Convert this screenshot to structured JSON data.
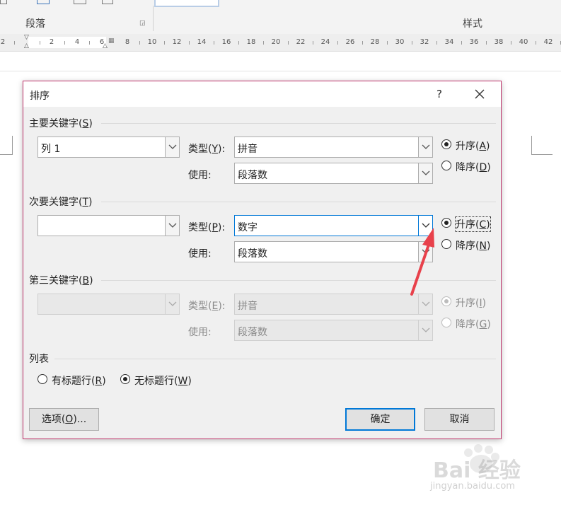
{
  "ribbon": {
    "paragraph_group": "段落",
    "styles_group": "样式"
  },
  "ruler": {
    "left_numbers": [
      "2",
      "2",
      "4",
      "6"
    ],
    "right_numbers": [
      "8",
      "10",
      "12",
      "14",
      "16",
      "18",
      "20",
      "22",
      "24",
      "26",
      "28",
      "30",
      "32",
      "34",
      "36",
      "38",
      "40",
      "42"
    ]
  },
  "dialog": {
    "title": "排序",
    "help": "?",
    "primary": {
      "heading": "主要关键字",
      "heading_key": "S",
      "column_value": "列 1",
      "type_label": "类型",
      "type_key": "Y",
      "type_value": "拼音",
      "using_label": "使用:",
      "using_value": "段落数",
      "ascending": "升序",
      "ascending_key": "A",
      "descending": "降序",
      "descending_key": "D",
      "selected": "ascending"
    },
    "secondary": {
      "heading": "次要关键字",
      "heading_key": "T",
      "column_value": "",
      "type_label": "类型",
      "type_key": "P",
      "type_value": "数字",
      "using_label": "使用:",
      "using_value": "段落数",
      "ascending": "升序",
      "ascending_key": "C",
      "descending": "降序",
      "descending_key": "N",
      "selected": "ascending"
    },
    "tertiary": {
      "heading": "第三关键字",
      "heading_key": "B",
      "column_value": "",
      "type_label": "类型",
      "type_key": "E",
      "type_value": "拼音",
      "using_label": "使用:",
      "using_value": "段落数",
      "ascending": "升序",
      "ascending_key": "I",
      "descending": "降序",
      "descending_key": "G",
      "disabled": true
    },
    "list": {
      "heading": "列表",
      "has_header": "有标题行",
      "has_header_key": "R",
      "no_header": "无标题行",
      "no_header_key": "W",
      "selected": "no_header"
    },
    "options_button": "选项",
    "options_key": "O",
    "options_suffix": "...",
    "ok_button": "确定",
    "cancel_button": "取消"
  },
  "watermark": {
    "brand": "Bai 经验",
    "domain": "jingyan.baidu.com"
  },
  "colors": {
    "dialog_border": "#c0336b",
    "accent": "#0078d7",
    "annotation_arrow": "#e8414b"
  }
}
